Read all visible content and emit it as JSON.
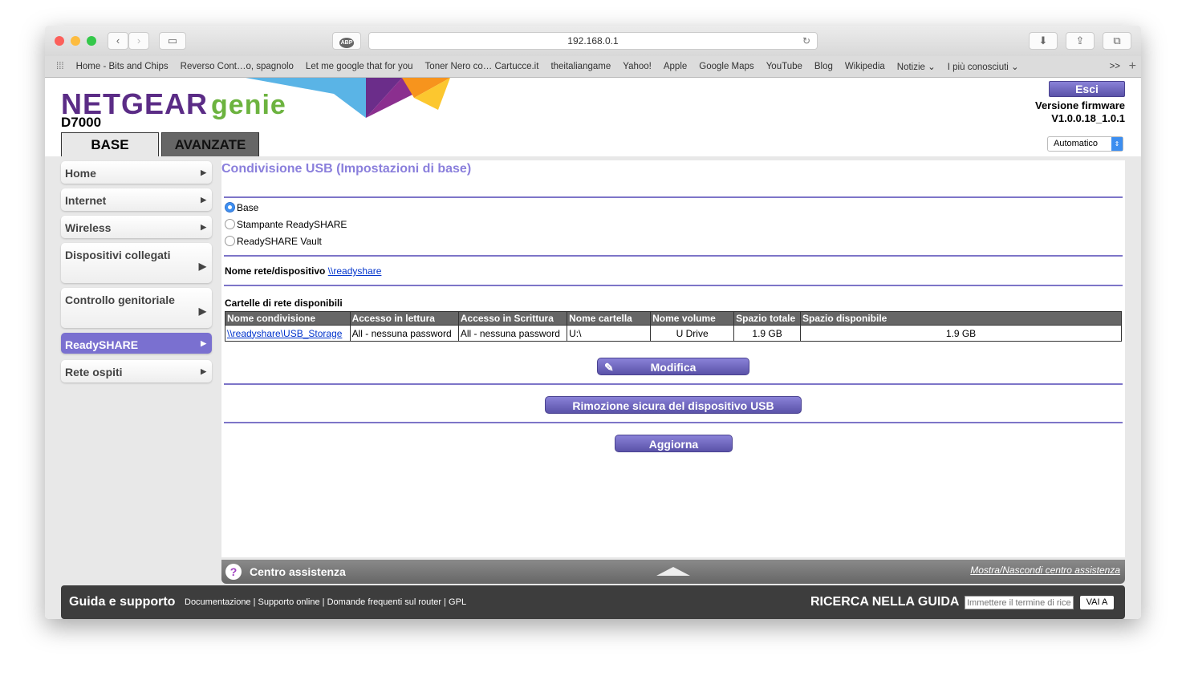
{
  "browser": {
    "url": "192.168.0.1",
    "adblock": "ABP",
    "bookmarks": [
      "Home - Bits and Chips",
      "Reverso Cont…o, spagnolo",
      "Let me google that for you",
      "Toner Nero co… Cartucce.it",
      "theitaliangame",
      "Yahoo!",
      "Apple",
      "Google Maps",
      "YouTube",
      "Blog",
      "Wikipedia",
      "Notizie ⌄",
      "I più conosciuti ⌄"
    ],
    "overflow": ">>"
  },
  "header": {
    "brand": "NETGEAR",
    "product": "genie",
    "model": "D7000",
    "logout": "Esci",
    "firmware_label": "Versione firmware",
    "firmware": "V1.0.0.18_1.0.1",
    "language": "Automatico",
    "tabs": [
      "BASE",
      "AVANZATE"
    ]
  },
  "sidebar": [
    "Home",
    "Internet",
    "Wireless",
    "Dispositivi collegati",
    "Controllo genitoriale",
    "ReadySHARE",
    "Rete ospiti"
  ],
  "main": {
    "title": "Condivisione USB (Impostazioni di base)",
    "options": [
      "Base",
      "Stampante ReadySHARE",
      "ReadySHARE Vault"
    ],
    "selected": "Base",
    "net_name_label": "Nome rete/dispositivo",
    "net_name": "\\\\readyshare",
    "folders_label": "Cartelle di rete disponibili",
    "columns": [
      "Nome condivisione",
      "Accesso in lettura",
      "Accesso in Scrittura",
      "Nome cartella",
      "Nome volume",
      "Spazio totale",
      "Spazio disponibile"
    ],
    "rows": [
      [
        "\\\\readyshare\\USB_Storage",
        "All - nessuna password",
        "All - nessuna password",
        "U:\\",
        "U Drive",
        "1.9 GB",
        "1.9 GB"
      ]
    ],
    "edit": "Modifica",
    "remove": "Rimozione sicura del dispositivo USB",
    "refresh": "Aggiorna"
  },
  "help": {
    "title": "Centro assistenza",
    "toggle": "Mostra/Nascondi centro assistenza"
  },
  "footer": {
    "title": "Guida e supporto",
    "links": [
      "Documentazione",
      "Supporto online",
      "Domande frequenti sul router",
      "GPL"
    ],
    "search_label": "RICERCA NELLA GUIDA",
    "search_placeholder": "Immettere il termine di ricerca",
    "go": "VAI A"
  }
}
